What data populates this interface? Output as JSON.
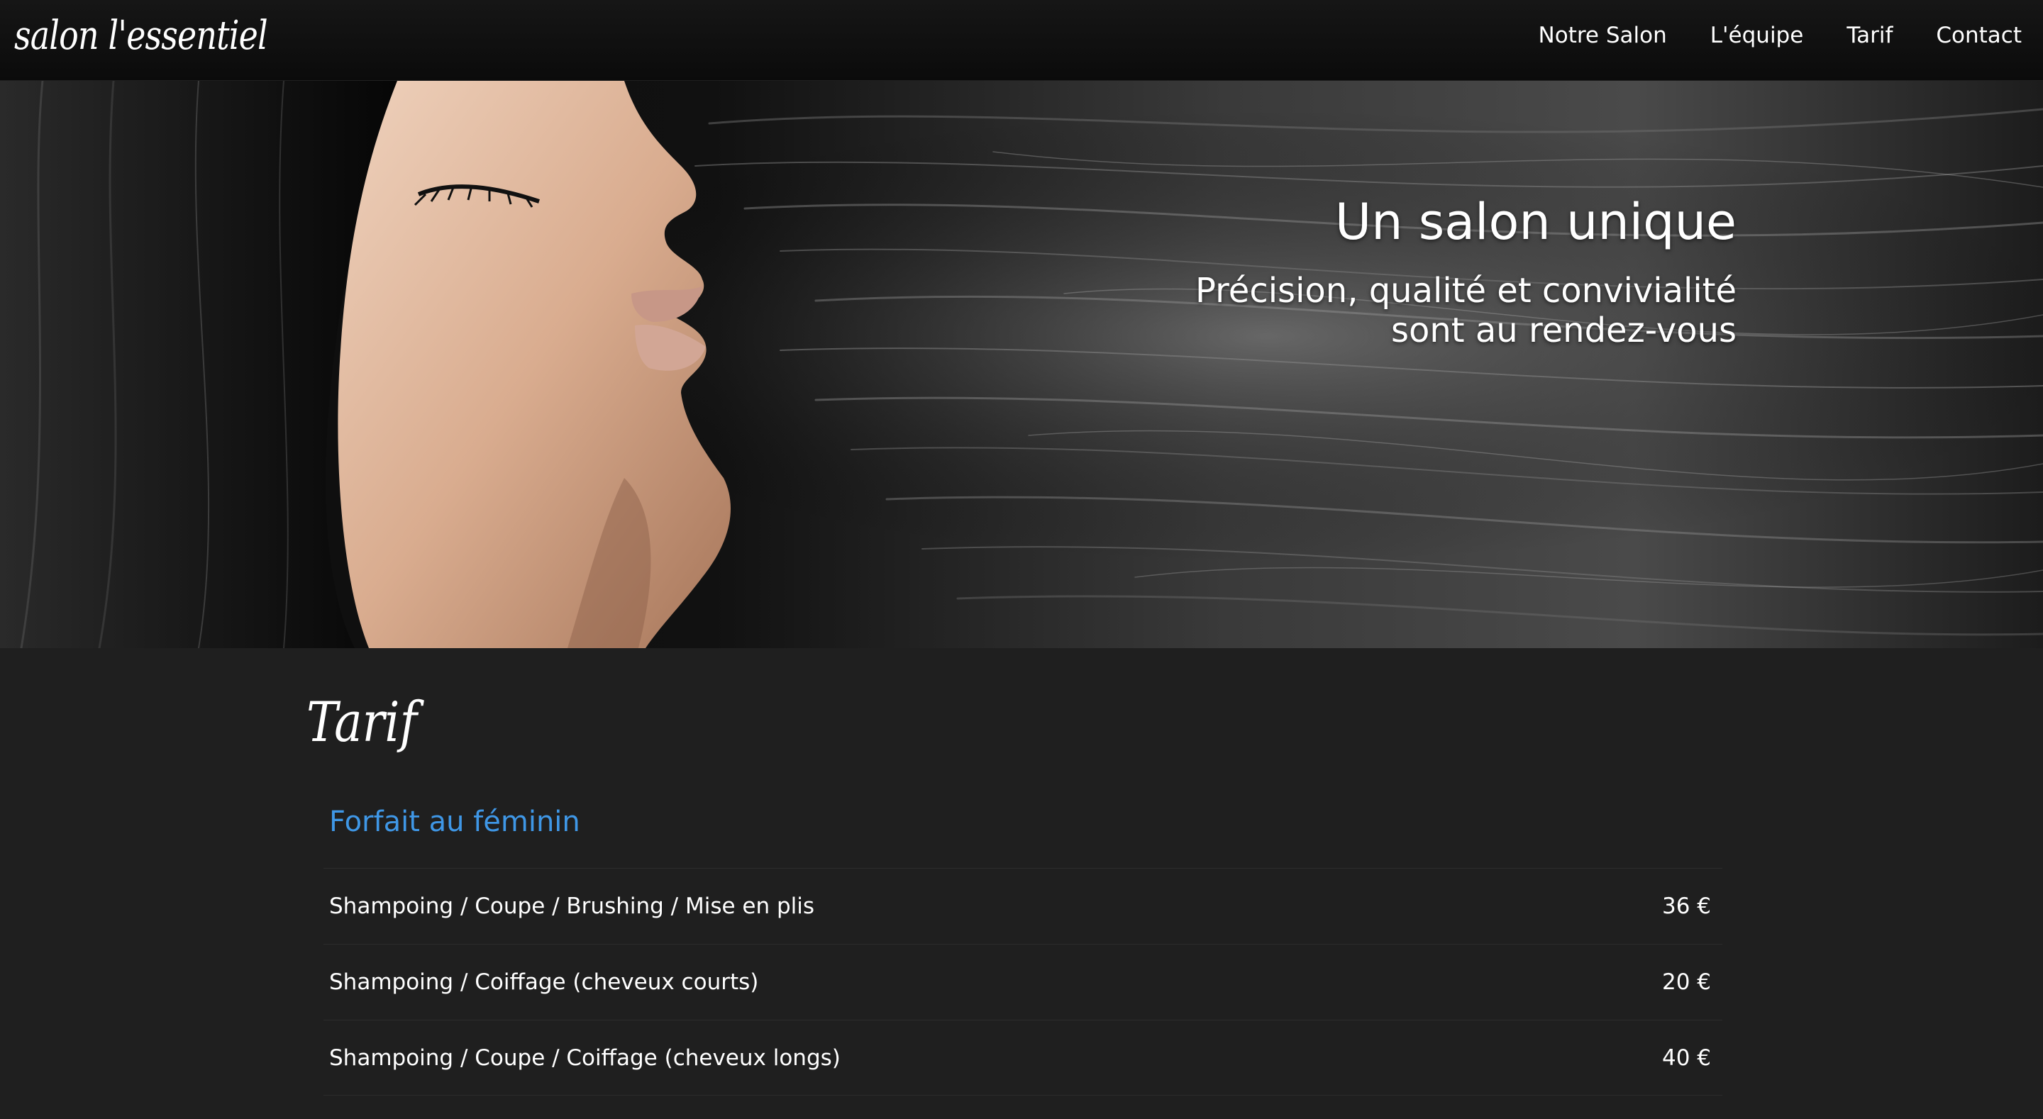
{
  "navbar": {
    "brand": "salon l'essentiel",
    "links": [
      "Notre Salon",
      "L'équipe",
      "Tarif",
      "Contact"
    ]
  },
  "hero": {
    "title": "Un salon unique",
    "subtitle_line1": "Précision, qualité et convivialité",
    "subtitle_line2": "sont au rendez-vous"
  },
  "tarif": {
    "title": "Tarif",
    "category": "Forfait au féminin",
    "items": [
      {
        "service": "Shampoing / Coupe / Brushing / Mise en plis",
        "price": "36 €"
      },
      {
        "service": "Shampoing / Coiffage (cheveux courts)",
        "price": "20 €"
      },
      {
        "service": "Shampoing / Coupe / Coiffage (cheveux longs)",
        "price": "40 €"
      }
    ]
  },
  "colors": {
    "background": "#1f1f1f",
    "navbar": "#111111",
    "accent": "#3f97e6",
    "text": "#ffffff"
  }
}
